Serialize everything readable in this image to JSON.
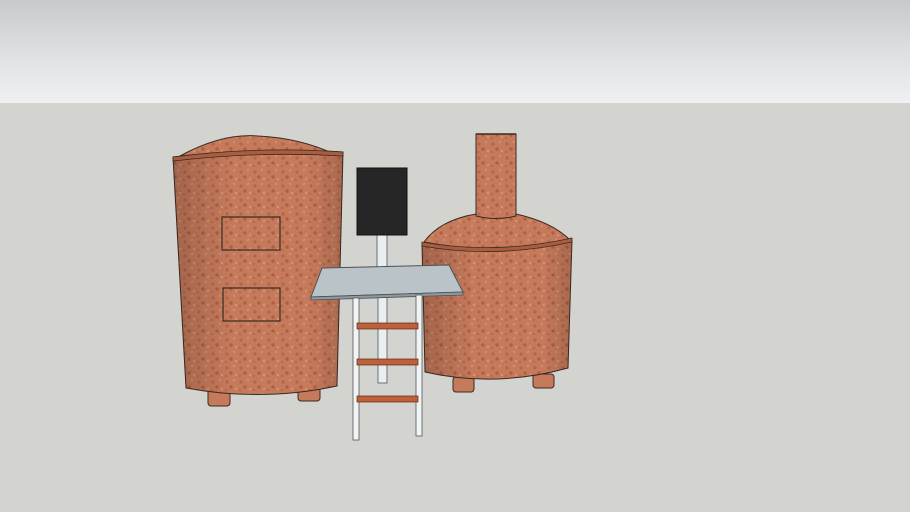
{
  "scene": {
    "sky_color": "#e6e8ea",
    "ground_color": "#d3d3cf",
    "vessel_color": "#c57a5c",
    "vessel_dark": "#a85c40",
    "outline_color": "#3a2a22",
    "platform_color": "#b9c3c8",
    "ladder_rung_color": "#c0603a",
    "panel_color": "#262626"
  }
}
